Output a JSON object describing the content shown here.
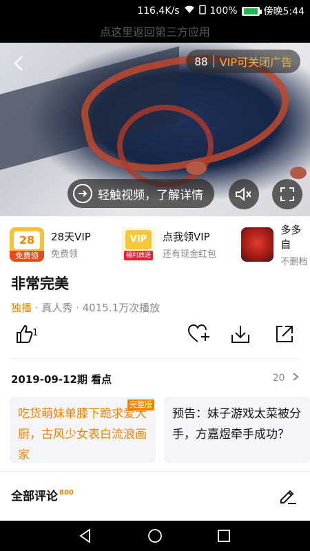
{
  "status_bar": {
    "network_speed": "116.4K/s",
    "battery_percent": "100%",
    "time": "傍晚5:44"
  },
  "return_banner": "点这里返回第三方应用",
  "video": {
    "ad_counter": "88",
    "ad_label": "VIP可关闭广告",
    "detail_label": "轻触视频，了解详情"
  },
  "promos": [
    {
      "title": "28天VIP",
      "subtitle": "免费领",
      "logo_text": "28天",
      "logo_badge": "免费领"
    },
    {
      "title": "点我领VIP",
      "subtitle": "还有现金红包",
      "logo_text": "VIP",
      "logo_badge": "福利放送"
    },
    {
      "title": "多多自",
      "subtitle": "不删档",
      "logo_text": "",
      "logo_badge": ""
    }
  ],
  "show": {
    "title": "非常完美",
    "exclusive": "独播",
    "meta": " · 真人秀 · 4015.1万次播放",
    "like_count": "1"
  },
  "episode": {
    "heading": "2019-09-12期 看点",
    "count": "20",
    "cards": [
      {
        "text": "吃货萌妹单膝下跪求爱大厨，古风少女表白流浪画家",
        "badge": "完整版"
      },
      {
        "text": "预告：妹子游戏太菜被分手，方嘉煜牵手成功？",
        "badge": ""
      }
    ]
  },
  "comments": {
    "label": "全部评论",
    "count": "800"
  },
  "colors": {
    "accent": "#f08300",
    "card_bg": "#f3f5f9"
  }
}
